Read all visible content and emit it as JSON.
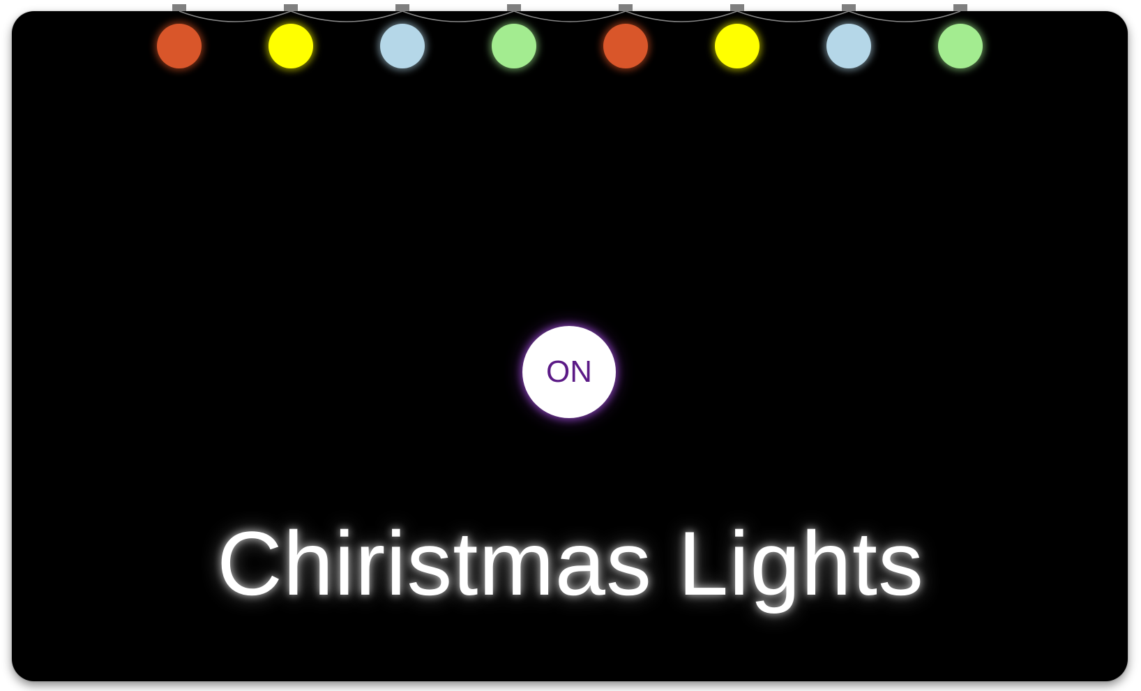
{
  "window": {
    "background": "#000000"
  },
  "lights": [
    {
      "name": "red-bulb",
      "color": "#d9562a",
      "glow": "rgba(230,90,40,0.55)"
    },
    {
      "name": "yellow-bulb",
      "color": "#ffff00",
      "glow": "rgba(255,255,0,0.55)"
    },
    {
      "name": "blue-bulb",
      "color": "#b5d7e8",
      "glow": "rgba(181,215,232,0.55)"
    },
    {
      "name": "green-bulb",
      "color": "#a3ec90",
      "glow": "rgba(163,236,144,0.55)"
    },
    {
      "name": "red-bulb",
      "color": "#d9562a",
      "glow": "rgba(230,90,40,0.55)"
    },
    {
      "name": "yellow-bulb",
      "color": "#ffff00",
      "glow": "rgba(255,255,0,0.55)"
    },
    {
      "name": "blue-bulb",
      "color": "#b5d7e8",
      "glow": "rgba(181,215,232,0.55)"
    },
    {
      "name": "green-bulb",
      "color": "#a3ec90",
      "glow": "rgba(163,236,144,0.55)"
    }
  ],
  "power_button": {
    "label": "ON",
    "text_color": "#5b1a86"
  },
  "title": "Chiristmas Lights"
}
